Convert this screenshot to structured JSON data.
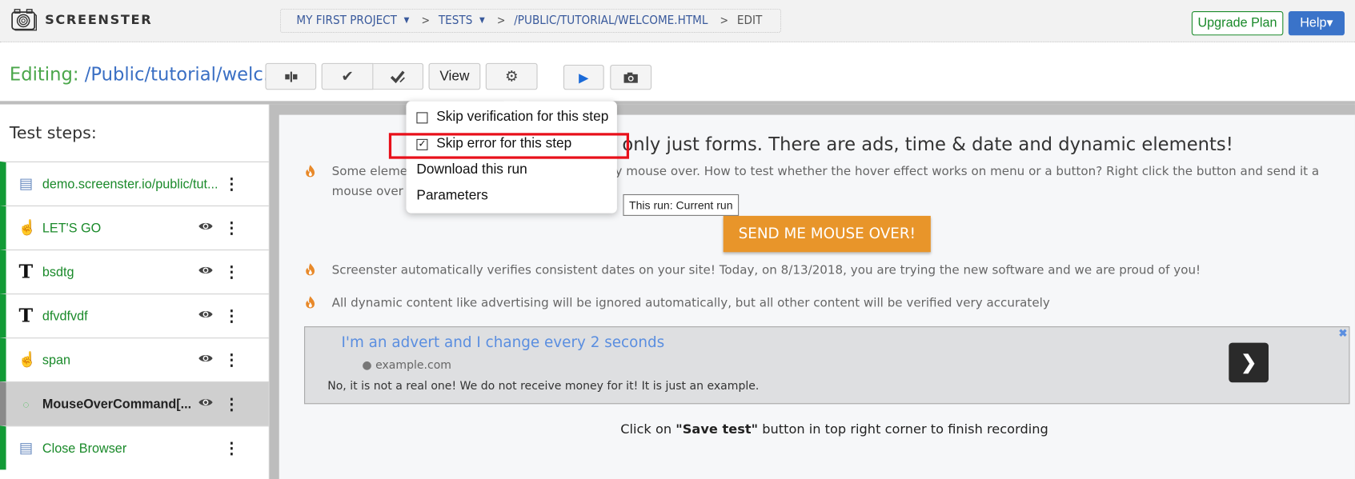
{
  "app": {
    "logo_text": "SCREENSTER",
    "breadcrumb": {
      "project": "MY FIRST PROJECT",
      "folder": "TESTS",
      "file": "/PUBLIC/TUTORIAL/WELCOME.HTML",
      "mode": "EDIT",
      "separator": ">",
      "caret": "▼"
    },
    "upgrade_label": "Upgrade Plan",
    "help_label": "Help▾"
  },
  "editor": {
    "editing_label": "Editing:",
    "editing_path": "/Public/tutorial/welc...",
    "toolbar": {
      "split_icon": "▮|▮",
      "verify_icon": "✔",
      "verify_all_icon": "✔̷",
      "view_label": "View",
      "settings_icon": "⚙",
      "play_icon": "▶",
      "screenshot_icon": "📷"
    }
  },
  "settings_menu": {
    "items": [
      {
        "label": "Skip verification for this step",
        "type": "checkbox",
        "checked": false
      },
      {
        "label": "Skip error for this step",
        "type": "checkbox",
        "checked": true
      },
      {
        "label": "Download this run",
        "type": "action"
      },
      {
        "label": "Parameters",
        "type": "action"
      }
    ],
    "check_mark": "✓"
  },
  "sidebar": {
    "title": "Test steps:",
    "steps": [
      {
        "icon": "browser-icon",
        "glyph": "▤",
        "label": "demo.screenster.io/public/tut...",
        "has_eye": false,
        "active": false
      },
      {
        "icon": "pointer-icon",
        "glyph": "☝",
        "label": "LET'S GO",
        "has_eye": true,
        "active": false
      },
      {
        "icon": "text-icon",
        "glyph": "T",
        "label": "bsdtg",
        "has_eye": true,
        "active": false
      },
      {
        "icon": "text-icon",
        "glyph": "T",
        "label": "dfvdfvdf",
        "has_eye": true,
        "active": false
      },
      {
        "icon": "pointer-icon",
        "glyph": "☝",
        "label": "span",
        "has_eye": true,
        "active": false
      },
      {
        "icon": "mouseover-icon",
        "glyph": "◌",
        "label": "MouseOverCommand[...",
        "has_eye": true,
        "active": true
      },
      {
        "icon": "browser-icon",
        "glyph": "▤",
        "label": "Close Browser",
        "has_eye": false,
        "active": false
      }
    ],
    "eye_glyph": "👁",
    "kebab_glyph": "⋮"
  },
  "page": {
    "heading": "only just forms. There are ads, time & date and dynamic elements!",
    "para1_line1": "Some elemen                                       mple - by mouse over. How to test whether the hover effect works on menu or a button? Right click the button and send it a",
    "para1_line2": "mouse over e",
    "tooltip": "This run: Current run",
    "send_button": "SEND ME MOUSE OVER!",
    "para2": "Screenster automatically verifies consistent dates on your site! Today, on 8/13/2018, you are trying the new software and we are proud of you!",
    "para3": "All dynamic content like advertising will be ignored automatically, but all other content will be verified very accurately",
    "flame_glyph": "🔥",
    "advert": {
      "title": "I'm an advert and I change every 2 seconds",
      "site": "example.com",
      "globe_glyph": "🌍",
      "description": "No, it is not a real one! We do not receive money for it! It is just an example.",
      "next_glyph": "❯",
      "close_glyph": "✖"
    },
    "save_note_pre": "Click on ",
    "save_note_bold": "\"Save test\"",
    "save_note_post": " button in top right corner to finish recording"
  },
  "colors": {
    "accent_green": "#129a36",
    "link_blue": "#3a6fc4",
    "orange": "#e8952a",
    "highlight_red": "#e8101a"
  }
}
